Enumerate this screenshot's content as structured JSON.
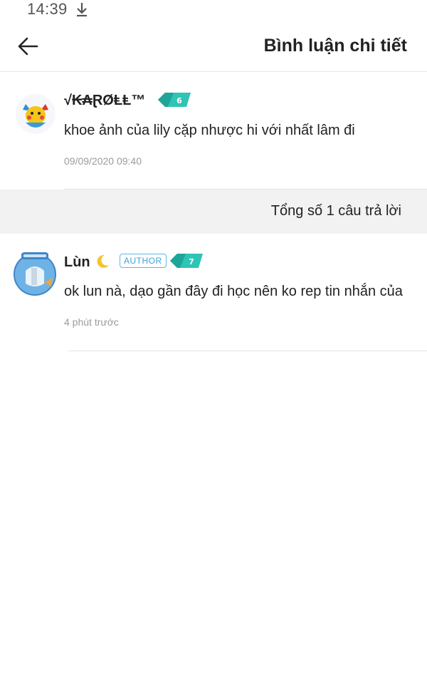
{
  "status_bar": {
    "time": "14:39"
  },
  "header": {
    "title": "Bình luận chi tiết"
  },
  "main_comment": {
    "username": "√₭₳ⱤØⱠⱠ™",
    "level": "6",
    "text": "khoe ảnh của lily cặp nhược hi với nhất lâm đi",
    "time": "09/09/2020 09:40"
  },
  "reply_summary": {
    "label": "Tổng số 1 câu trả lời"
  },
  "replies": [
    {
      "username": "Lùn",
      "author_badge": "AUTHOR",
      "level": "7",
      "text": "ok lun nà, dạo gần đây đi học nên ko rep tin nhắn của",
      "time": "4 phút trước"
    }
  ],
  "colors": {
    "badge": "#2ec4b6",
    "author": "#3aa3dc",
    "muted": "#9a9a9a",
    "band": "#f2f2f2"
  }
}
